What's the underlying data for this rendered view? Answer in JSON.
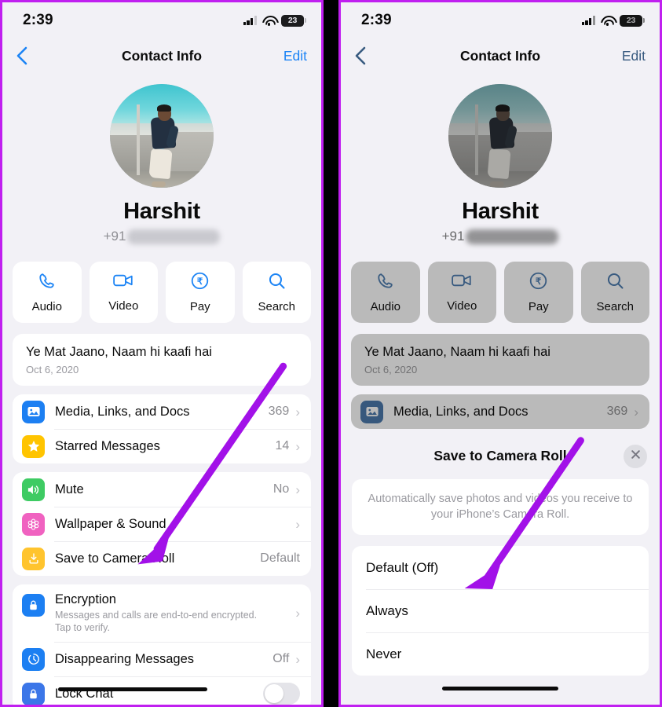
{
  "meta": {
    "accent_purple": "#a211e8",
    "panel_border": "#c01ff0",
    "ios_blue": "#1c84f5"
  },
  "status_bar": {
    "time": "2:39",
    "battery_level": "23",
    "signal_icon": "cellular-signal-icon",
    "wifi_icon": "wifi-icon",
    "battery_icon": "battery-icon"
  },
  "nav": {
    "back_icon": "chevron-left-icon",
    "title": "Contact Info",
    "edit_label": "Edit"
  },
  "profile": {
    "avatar_alt": "contact-photo",
    "name": "Harshit",
    "phone_prefix": "+91",
    "phone_redacted": true
  },
  "actions": [
    {
      "label": "Audio",
      "icon": "phone-icon"
    },
    {
      "label": "Video",
      "icon": "video-camera-icon"
    },
    {
      "label": "Pay",
      "icon": "rupee-pay-icon"
    },
    {
      "label": "Search",
      "icon": "search-icon"
    }
  ],
  "about": {
    "text": "Ye Mat Jaano, Naam hi kaafi hai",
    "date": "Oct 6, 2020"
  },
  "media_rows": [
    {
      "label": "Media, Links, and Docs",
      "value": "369",
      "icon": "photo-icon",
      "icon_color": "#1c7ff2",
      "chevron": "›"
    },
    {
      "label": "Starred Messages",
      "value": "14",
      "icon": "star-icon",
      "icon_color": "#ffc400",
      "chevron": "›"
    }
  ],
  "settings_rows": [
    {
      "label": "Mute",
      "value": "No",
      "icon": "speaker-icon",
      "icon_color": "#3ecb63",
      "chevron": "›"
    },
    {
      "label": "Wallpaper & Sound",
      "value": "",
      "icon": "wallpaper-flower-icon",
      "icon_color": "#f062c0",
      "chevron": "›"
    },
    {
      "label": "Save to Camera Roll",
      "value": "Default",
      "icon": "save-download-icon",
      "icon_color": "#ffc42e",
      "chevron": ""
    }
  ],
  "privacy_rows": [
    {
      "label": "Encryption",
      "sub": "Messages and calls are end-to-end encrypted.\nTap to verify.",
      "value": "",
      "icon": "lock-icon",
      "icon_color": "#1c7ff2",
      "chevron": "›"
    },
    {
      "label": "Disappearing Messages",
      "value": "Off",
      "icon": "timer-icon",
      "icon_color": "#1c7ff2",
      "chevron": "›"
    },
    {
      "label": "Lock Chat",
      "value": "",
      "icon": "lock-chat-icon",
      "icon_color": "#3b76e8",
      "chevron": "",
      "toggle": "off",
      "redacted": true
    }
  ],
  "sheet": {
    "title": "Save to Camera Roll",
    "close_icon": "close-icon",
    "description": "Automatically save photos and videos you receive to your iPhone’s Camera Roll.",
    "options": [
      {
        "label": "Default (Off)"
      },
      {
        "label": "Always"
      },
      {
        "label": "Never"
      }
    ]
  },
  "annotations": [
    {
      "name": "arrow-to-save-to-camera-roll",
      "panel": "left",
      "target": "Save to Camera Roll row"
    },
    {
      "name": "arrow-to-always-option",
      "panel": "right",
      "target": "Always option"
    }
  ]
}
